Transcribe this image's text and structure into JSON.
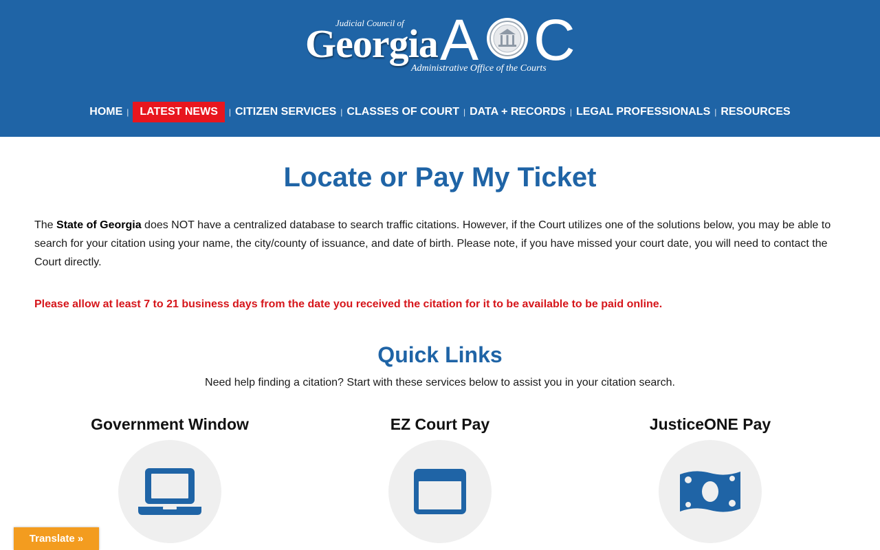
{
  "header": {
    "logo_top": "Judicial Council of",
    "logo_main": "Georgia",
    "logo_aoc_a": "A",
    "logo_aoc_c": "C",
    "logo_sub": "Administrative Office of the Courts",
    "bg_color": "#1f64a6"
  },
  "nav": {
    "items": [
      {
        "label": "HOME",
        "active": false
      },
      {
        "label": "LATEST NEWS",
        "active": true
      },
      {
        "label": "CITIZEN SERVICES",
        "active": false
      },
      {
        "label": "CLASSES OF COURT",
        "active": false
      },
      {
        "label": "DATA + RECORDS",
        "active": false
      },
      {
        "label": "LEGAL PROFESSIONALS",
        "active": false
      },
      {
        "label": "RESOURCES",
        "active": false
      }
    ],
    "active_color": "#e8161e"
  },
  "main": {
    "title": "Locate or Pay My Ticket",
    "intro_prefix": "The ",
    "intro_bold": "State of Georgia",
    "intro_rest": " does NOT have a centralized database to search traffic citations. However, if the Court utilizes one of the solutions below, you may be able to search for your citation using your name, the city/county of issuance, and date of birth. Please note, if you have missed your court date, you will need to contact the Court directly.",
    "notice": "Please allow at least 7 to 21 business days from the date you received the citation for it to be available to be paid online.",
    "notice_color": "#d6161b"
  },
  "quick_links": {
    "title": "Quick Links",
    "subtitle": "Need help finding a citation? Start with these services below to assist you in your citation search.",
    "cards": [
      {
        "title": "Government Window",
        "icon": "laptop-icon"
      },
      {
        "title": "EZ Court Pay",
        "icon": "browser-window-icon"
      },
      {
        "title": "JusticeONE Pay",
        "icon": "money-bill-icon"
      }
    ]
  },
  "translate": {
    "label": "Translate »"
  }
}
